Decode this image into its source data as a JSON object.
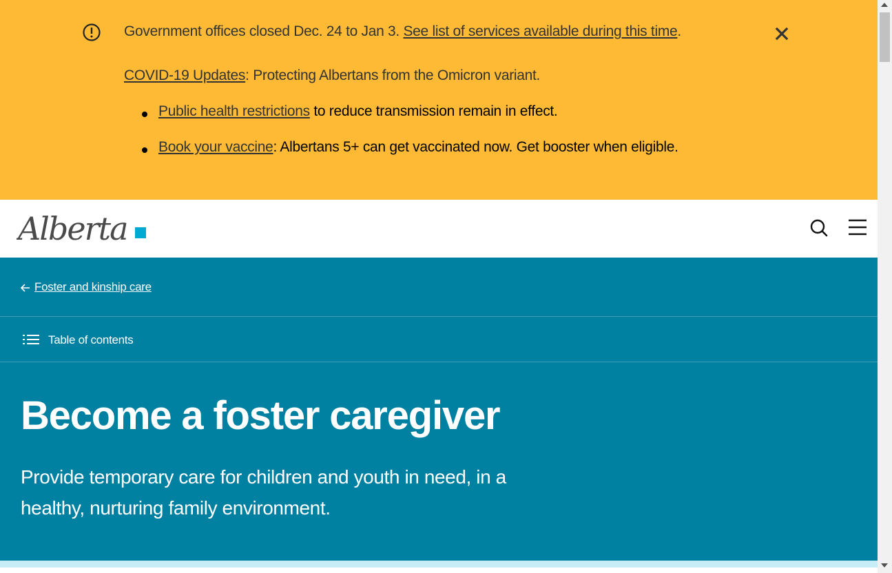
{
  "alert": {
    "line1_text": "Government offices closed Dec. 24 to Jan 3. ",
    "line1_link": "See list of services available during this time",
    "line1_end": ".",
    "line2_link": "COVID-19 Updates",
    "line2_text": ": Protecting Albertans from the Omicron variant.",
    "bullets": [
      {
        "link": "Public health restrictions",
        "text": " to reduce transmission remain in effect."
      },
      {
        "link": "Book your vaccine",
        "text": ": Albertans 5+ can get vaccinated now. Get booster when eligible."
      }
    ],
    "icons": {
      "alert": "alert-circle-icon",
      "close": "close-icon"
    }
  },
  "header": {
    "logo_text": "Alberta",
    "icons": {
      "search": "search-icon",
      "menu": "hamburger-menu-icon"
    }
  },
  "hero": {
    "back_link": "Foster and kinship care",
    "toc_label": "Table of contents",
    "title": "Become a foster caregiver",
    "lead": "Provide temporary care for children and youth in need, in a healthy, nurturing family environment."
  },
  "colors": {
    "alert_bg": "#FEBA35",
    "hero_bg": "#0081A2",
    "logo_square": "#00AAD2",
    "accent_strip": "#C7EDF6",
    "text_dark": "#333333"
  }
}
